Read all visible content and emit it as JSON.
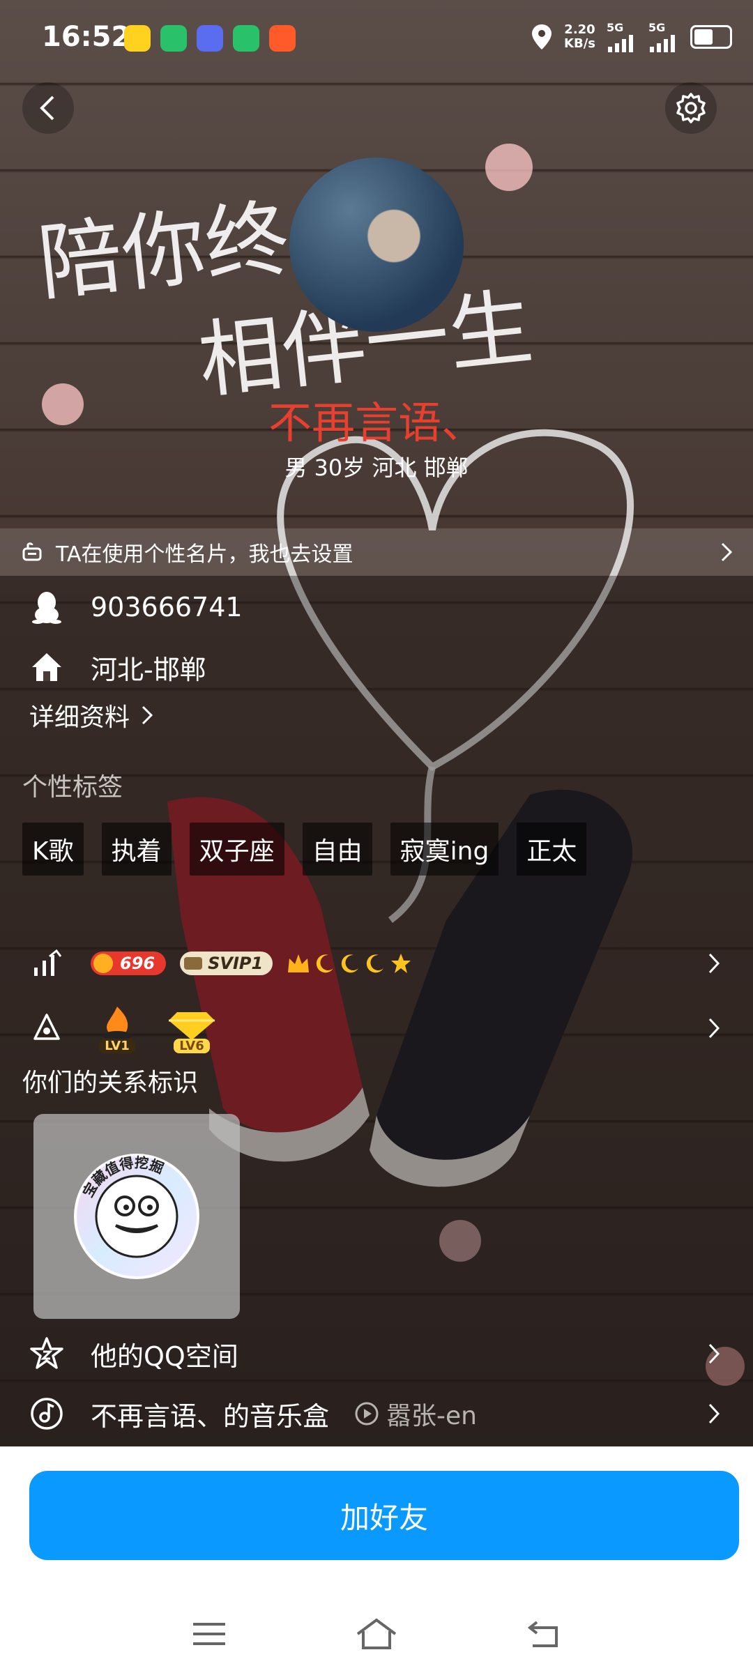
{
  "status_bar": {
    "time": "16:52",
    "speed_value": "2.20",
    "speed_unit": "KB/s",
    "net1": "5G",
    "net2": "5G",
    "battery_level": 0.55,
    "app_icons": [
      "yellow-app-icon",
      "wechat-icon",
      "bot-app-icon",
      "wechat-icon-2",
      "orange-app-icon"
    ]
  },
  "header": {
    "back_icon": "chevron-left-icon",
    "settings_icon": "gear-icon",
    "cover_art_text_1": "陪你终",
    "cover_art_text_2": "相伴一生"
  },
  "profile": {
    "nickname": "不再言语、",
    "info": "男 30岁 河北 邯郸",
    "nickname_color": "#e8402e"
  },
  "banner": {
    "text": "TA在使用个性名片，我也去设置"
  },
  "info": {
    "qq_number": "903666741",
    "hometown": "河北-邯郸",
    "details_label": "详细资料"
  },
  "tags_section": {
    "title": "个性标签",
    "tags": [
      "K歌",
      "执着",
      "双子座",
      "自由",
      "寂寞ing",
      "正太"
    ]
  },
  "levels": {
    "coin_value": "696",
    "svip_label": "SVIP1",
    "medal1_label": "LV1",
    "medal2_label": "LV6"
  },
  "relation": {
    "title": "你们的关系标识",
    "sticker_text": "宝藏值得挖掘"
  },
  "links": {
    "qzone_label": "他的QQ空间",
    "music_label": "不再言语、的音乐盒",
    "song": "嚣张-en"
  },
  "actions": {
    "add_friend": "加好友"
  },
  "colors": {
    "accent": "#0a99ff",
    "white": "#ffffff"
  }
}
